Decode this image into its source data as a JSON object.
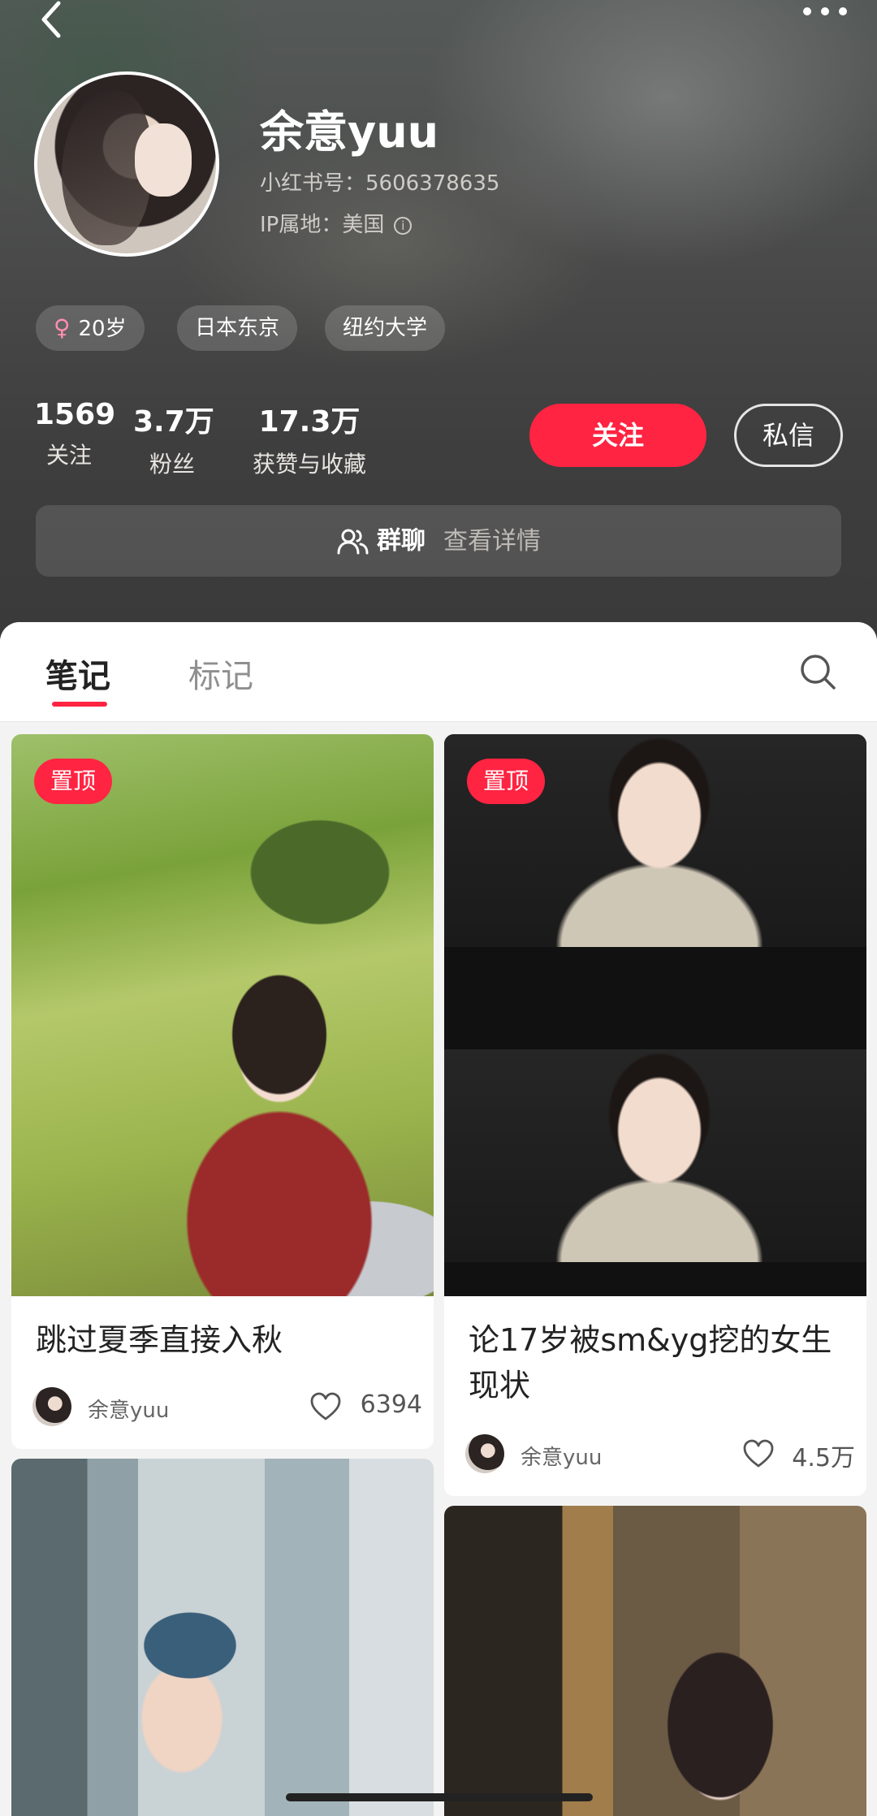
{
  "profile": {
    "username": "余意yuu",
    "red_id": "小红书号：5606378635",
    "ip_location": "IP属地：美国",
    "info_glyph": "i",
    "tags": {
      "age": "20岁",
      "city": "日本东京",
      "school": "纽约大学"
    },
    "female_glyph": "♀",
    "stats": {
      "following": {
        "value": "1569",
        "label": "关注"
      },
      "fans": {
        "value": "3.7万",
        "label": "粉丝"
      },
      "likes": {
        "value": "17.3万",
        "label": "获赞与收藏"
      }
    },
    "follow_label": "关注",
    "message_label": "私信",
    "group": {
      "label": "群聊",
      "detail": "查看详情"
    }
  },
  "tabs": {
    "notes": "笔记",
    "marks": "标记"
  },
  "notes": [
    {
      "pin": "置顶",
      "title": "跳过夏季直接入秋",
      "author": "余意yuu",
      "likes": "6394"
    },
    {
      "pin": "置顶",
      "title": "论17岁被sm&yg挖的女生现状",
      "author": "余意yuu",
      "likes": "4.5万"
    }
  ],
  "colors": {
    "accent": "#ff2442",
    "header_bg": "#4a4a4a"
  },
  "icons": [
    "back-icon",
    "more-icon",
    "info-icon",
    "female-icon",
    "group-icon",
    "search-icon",
    "heart-icon"
  ]
}
